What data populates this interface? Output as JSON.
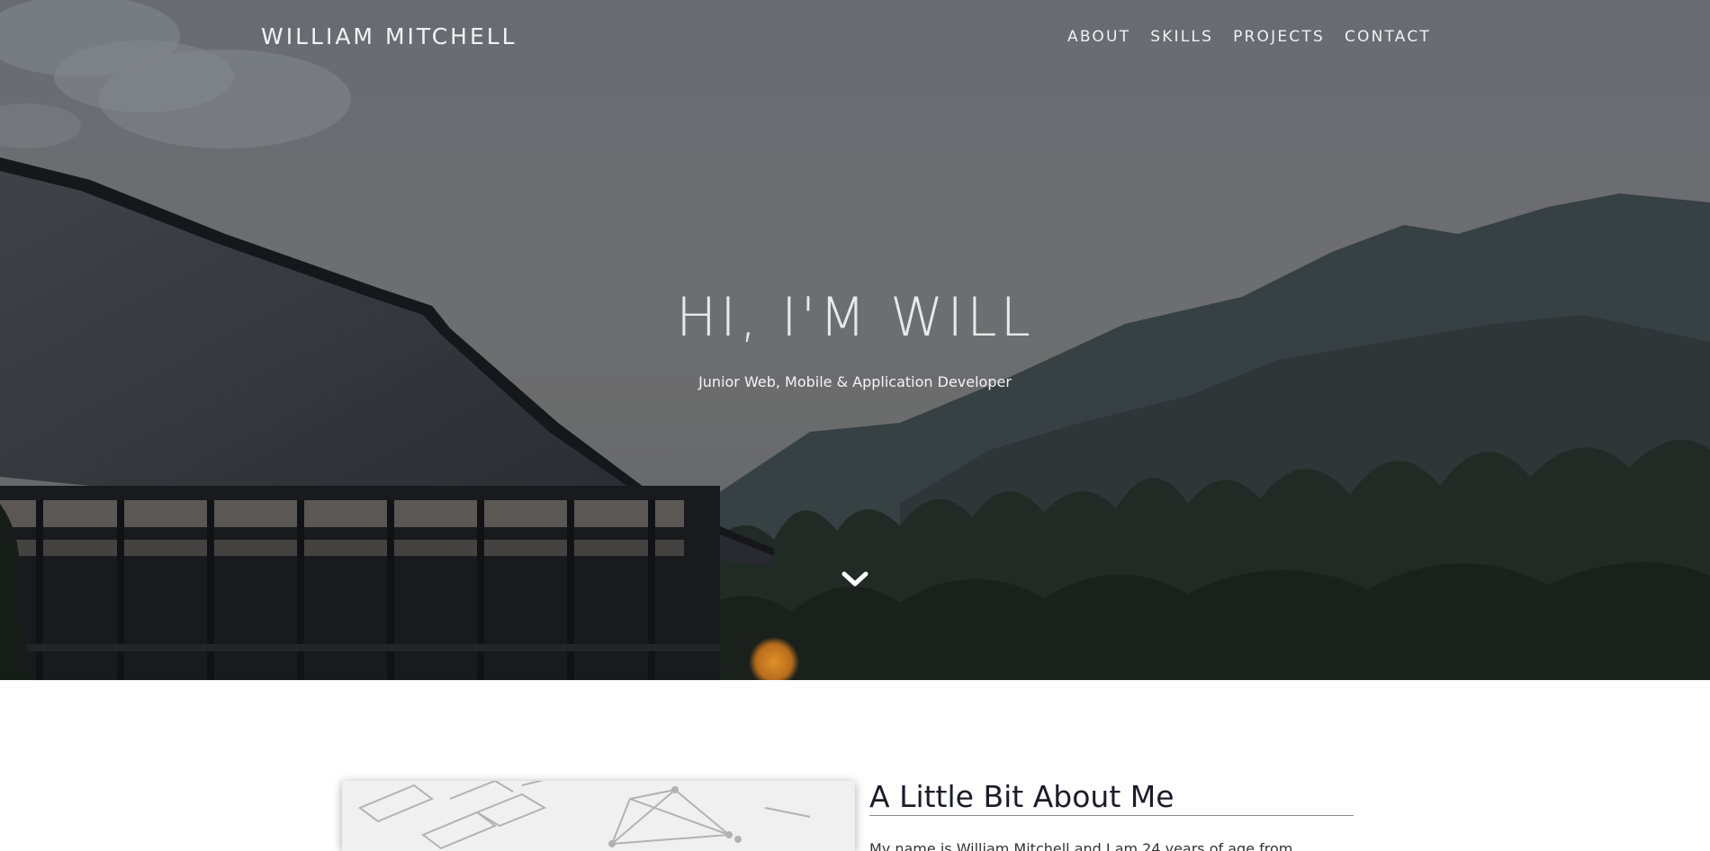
{
  "nav": {
    "brand": "WILLIAM MITCHELL",
    "links": [
      "ABOUT",
      "SKILLS",
      "PROJECTS",
      "CONTACT"
    ]
  },
  "hero": {
    "title": "HI, I'M WILL",
    "subtitle": "Junior Web, Mobile & Application Developer",
    "scroll_icon": "chevron-down-icon"
  },
  "about": {
    "heading": "A Little Bit About Me",
    "intro": "My name is William Mitchell and I am 24 years of age from"
  },
  "colors": {
    "overlay": "#6b6e72",
    "heading": "#1c1c2a",
    "nav_text": "#f1f1f1"
  }
}
